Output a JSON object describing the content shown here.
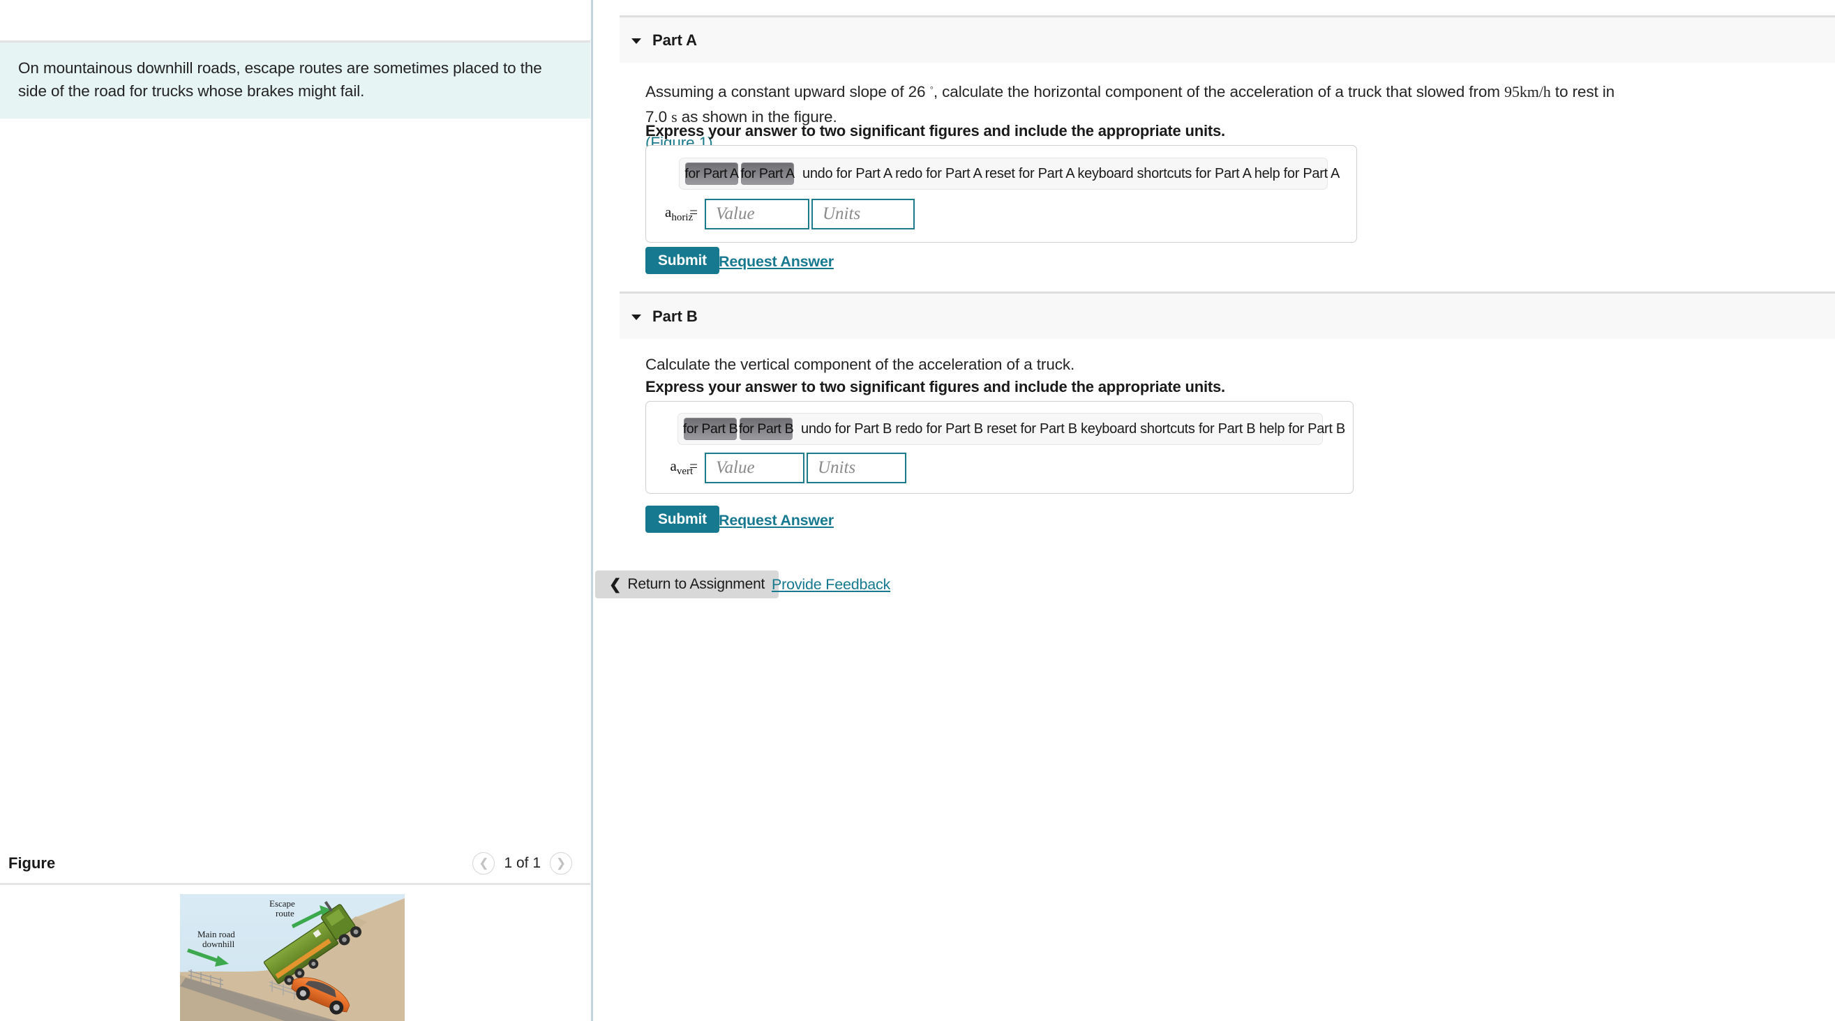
{
  "intro": {
    "text": "On mountainous downhill roads, escape routes are sometimes placed to the side of the road for trucks whose brakes might fail."
  },
  "figure_panel": {
    "title": "Figure",
    "prev_icon": "chevron-left-icon",
    "next_icon": "chevron-right-icon",
    "page_count": "1 of 1",
    "illustration": {
      "escape_route_label": "Escape\nroute",
      "escape_route_line1": "Escape",
      "escape_route_line2": "route",
      "main_road_line1": "Main road",
      "main_road_line2": "downhill",
      "truck_color": "#6f8f2e",
      "car_color": "#e8712a",
      "sky_color": "#cfe5f0",
      "ground_color": "#d6c3a5",
      "arrow_color": "#3da94e"
    }
  },
  "parts": [
    {
      "id": "a",
      "header_label": "Part A",
      "caret_icon": "caret-down-icon",
      "question_prefix": "Assuming a constant upward slope of 26",
      "question_degree": "◦",
      "question_mid": ", calculate the horizontal component of the acceleration of a truck that slowed from ",
      "question_speed": "95km/h",
      "question_mid2": " to rest in 7.0 ",
      "question_unit_s": "s",
      "question_suffix": " as shown in the figure.",
      "figure_link": "(Figure 1)",
      "instruction": "Express your answer to two significant figures and include the appropriate units.",
      "toolbar_buttons": [
        "for Part A",
        "for Part A"
      ],
      "toolbar_text": "undo for Part A  redo for Part A  reset for Part A  keyboard shortcuts for Part A  help for Part A",
      "var_symbol": "a",
      "var_subscript": "horiz",
      "var_equals": "=",
      "value_placeholder": "Value",
      "units_placeholder": "Units",
      "submit_label": "Submit",
      "request_answer_label": "Request Answer"
    },
    {
      "id": "b",
      "header_label": "Part B",
      "caret_icon": "caret-down-icon",
      "question_text": "Calculate the vertical component of the acceleration of a truck.",
      "instruction": "Express your answer to two significant figures and include the appropriate units.",
      "toolbar_buttons": [
        "for Part B",
        "for Part B"
      ],
      "toolbar_text": "undo for Part B  redo for Part B  reset for Part B  keyboard shortcuts for Part B  help for Part B",
      "var_symbol": "a",
      "var_subscript": "vert",
      "var_equals": "=",
      "value_placeholder": "Value",
      "units_placeholder": "Units",
      "submit_label": "Submit",
      "request_answer_label": "Request Answer"
    }
  ],
  "footer": {
    "return_label": "Return to Assignment",
    "back_icon": "chevron-left-icon",
    "feedback_label": "Provide Feedback"
  },
  "colors": {
    "accent_teal": "#16798f",
    "intro_bg": "#e6f4f3",
    "part_header_bg": "#f8f8f8"
  }
}
